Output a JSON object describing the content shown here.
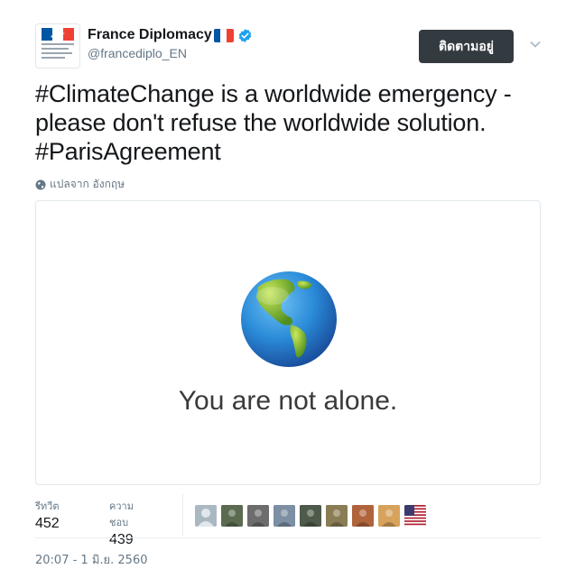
{
  "account": {
    "name": "France Diplomacy",
    "handle": "@francediplo_EN",
    "avatar_icon": "french-republic-logo",
    "flag_colors": [
      "#0055a4",
      "#ffffff",
      "#ef4135"
    ],
    "verified_color": "#1da1f2"
  },
  "follow_button": {
    "label": "ติดตามอยู่",
    "bg": "#333a40"
  },
  "tweet": {
    "lines": [
      "#ClimateChange is a worldwide emergency -",
      "please don't refuse the worldwide solution.",
      "#ParisAgreement"
    ]
  },
  "translate": {
    "label": "แปลจาก อังกฤษ",
    "icon": "globe-icon"
  },
  "media": {
    "caption": "You are not alone.",
    "icon": "earth-globe-emoji"
  },
  "stats": {
    "retweets_label": "รีทวีต",
    "retweets_value": "452",
    "likes_label": "ความชอบ",
    "likes_value": "439"
  },
  "likers": [
    {
      "color": "#aab8c2",
      "icon": "default-avatar"
    },
    {
      "color": "#5a6b4f",
      "icon": "user-avatar"
    },
    {
      "color": "#6d6d6d",
      "icon": "user-avatar"
    },
    {
      "color": "#7c8fa3",
      "icon": "user-avatar"
    },
    {
      "color": "#4e5a4a",
      "icon": "user-avatar"
    },
    {
      "color": "#8a7d55",
      "icon": "user-avatar"
    },
    {
      "color": "#b0643c",
      "icon": "user-avatar"
    },
    {
      "color": "#d7a25b",
      "icon": "user-avatar"
    },
    {
      "color": "#3c3b6e",
      "icon": "us-flag-avatar"
    }
  ],
  "timestamp": "20:07 - 1 มิ.ย. 2560"
}
